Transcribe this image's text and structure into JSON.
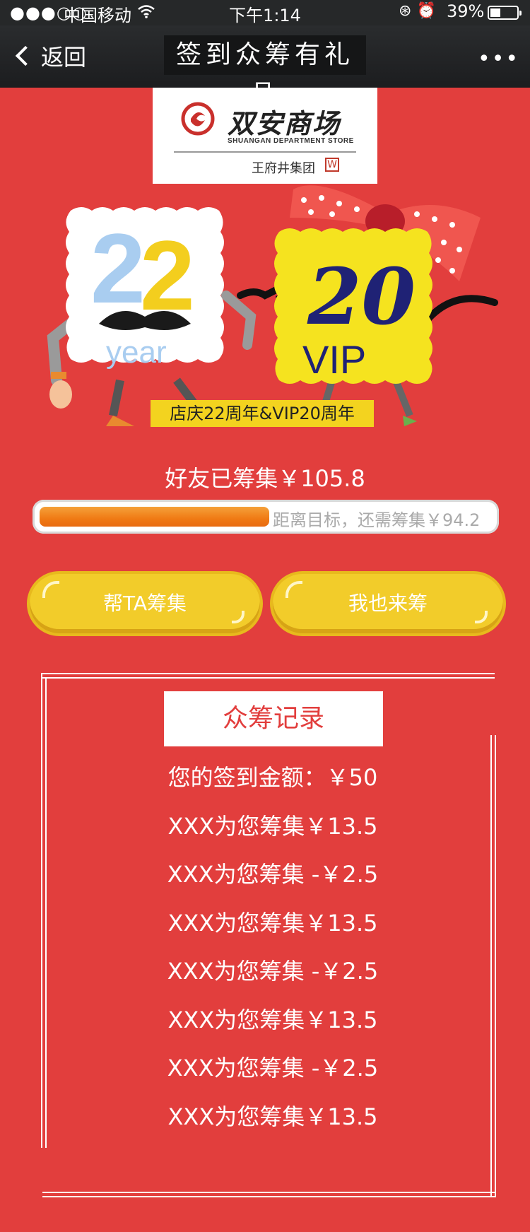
{
  "status_bar": {
    "signal": "●●●○○",
    "carrier": "中国移动",
    "time": "下午1:14",
    "battery_pct": "39%",
    "battery_level": 0.39
  },
  "nav": {
    "back_label": "返回",
    "title": "签到众筹有礼品",
    "more_label": "•••"
  },
  "logo": {
    "name_cn": "双安商场",
    "name_en": "SHUANGAN DEPARTMENT STORE",
    "group": "王府井集团"
  },
  "hero": {
    "year_number": "22",
    "year_word": "year",
    "vip_number": "20",
    "vip_word": "VIP",
    "banner": "店庆22周年&VIP20周年"
  },
  "funding": {
    "raised_text": "好友已筹集￥105.8",
    "remaining_text": "距离目标，还需筹集￥94.2",
    "progress_fraction": 0.529
  },
  "buttons": {
    "help_label": "帮TA筹集",
    "join_label": "我也来筹"
  },
  "records": {
    "title": "众筹记录",
    "items": [
      "您的签到金额：￥50",
      "XXX为您筹集￥13.5",
      "XXX为您筹集 -￥2.5",
      "XXX为您筹集￥13.5",
      "XXX为您筹集 -￥2.5",
      "XXX为您筹集￥13.5",
      "XXX为您筹集 -￥2.5",
      "XXX为您筹集￥13.5"
    ]
  },
  "colors": {
    "background": "#e23e3d",
    "button_yellow": "#f2cc2a",
    "progress_orange": "#f07a14"
  }
}
